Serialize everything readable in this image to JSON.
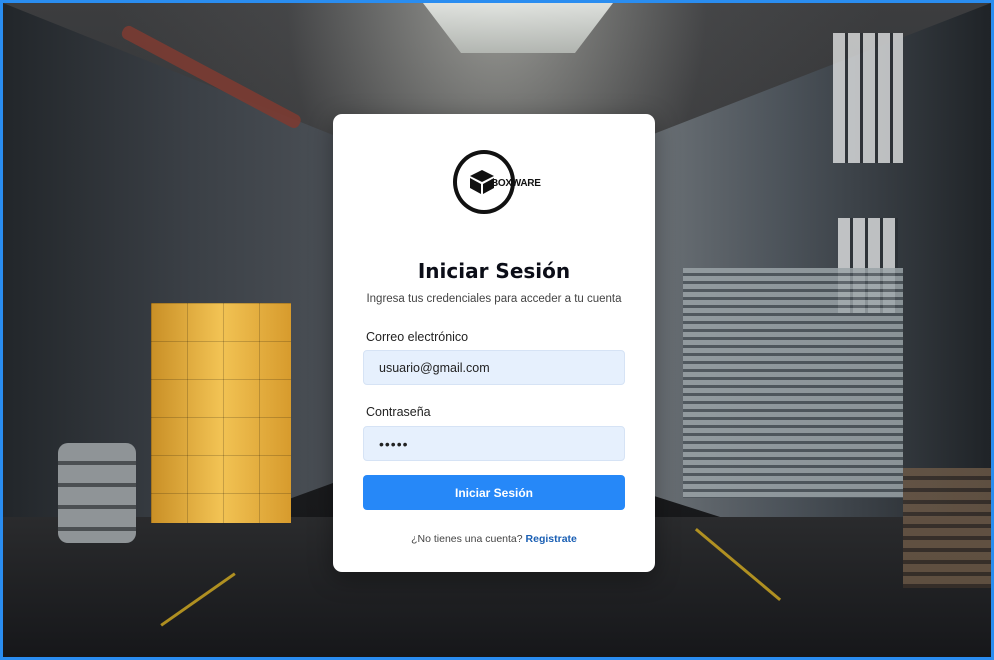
{
  "brand": {
    "name": "BOXWARE"
  },
  "login": {
    "title": "Iniciar Sesión",
    "subtitle": "Ingresa tus credenciales  para acceder a tu cuenta",
    "email_label": "Correo electrónico",
    "email_value": "usuario@gmail.com",
    "password_label": "Contraseña",
    "password_value": "•••••",
    "submit_label": "Iniciar Sesión",
    "footer_text": "¿No tienes  una cuenta?",
    "register_link": "Registrate"
  },
  "colors": {
    "accent": "#2688f8",
    "input_bg": "#e6f0fd",
    "link": "#1a5fb4",
    "frame_border": "#2a8df0"
  }
}
